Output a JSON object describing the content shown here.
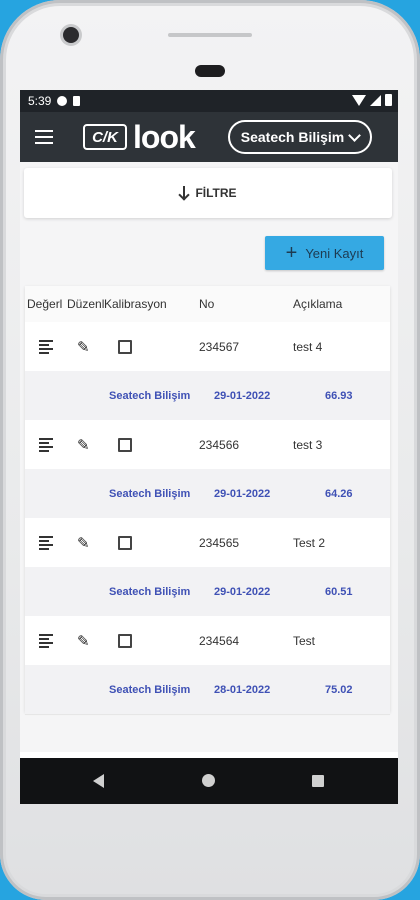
{
  "status_bar": {
    "time": "5:39"
  },
  "app_bar": {
    "logo_box": "C/K",
    "logo_text": "look",
    "company_selector": "Seatech Bilişim"
  },
  "filter": {
    "label": "FİLTRE"
  },
  "actions": {
    "new_record": "Yeni Kayıt"
  },
  "table": {
    "columns": [
      "Değerl",
      "Düzenl",
      "Kalibrasyon",
      "No",
      "Açıklama"
    ],
    "records": [
      {
        "no": "234567",
        "description": "test 4",
        "company": "Seatech Bilişim",
        "date": "29-01-2022",
        "value": "66.93"
      },
      {
        "no": "234566",
        "description": "test 3",
        "company": "Seatech Bilişim",
        "date": "29-01-2022",
        "value": "64.26"
      },
      {
        "no": "234565",
        "description": "Test 2",
        "company": "Seatech Bilişim",
        "date": "29-01-2022",
        "value": "60.51"
      },
      {
        "no": "234564",
        "description": "Test",
        "company": "Seatech Bilişim",
        "date": "28-01-2022",
        "value": "75.02"
      }
    ]
  },
  "icons": {
    "menu": "hamburger-icon",
    "evaluate": "lines-icon",
    "edit": "pencil-icon",
    "calibration": "checkbox-icon",
    "filter_arrow": "arrow-down-icon",
    "add": "plus-icon"
  },
  "colors": {
    "app_bar": "#2e3338",
    "accent_button": "#35a9e3",
    "detail_text": "#3f51b5",
    "background": "#26a4e0"
  }
}
